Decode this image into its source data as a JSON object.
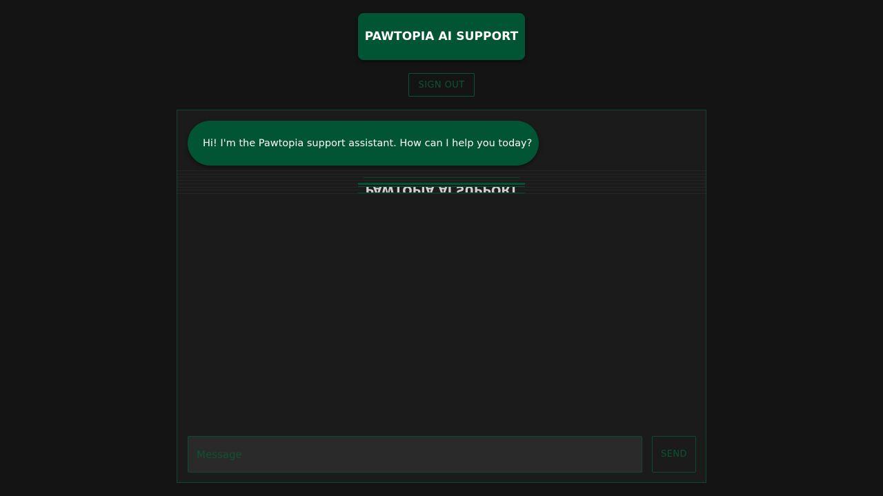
{
  "header": {
    "title": "PAWTOPIA AI SUPPORT",
    "sign_out_label": "SIGN OUT"
  },
  "chat": {
    "messages": [
      {
        "sender": "assistant",
        "text": "Hi! I'm the Pawtopia support assistant. How can I help you today?"
      }
    ],
    "input": {
      "value": "",
      "placeholder": "Message"
    },
    "send_label": "SEND"
  },
  "colors": {
    "page_background": "#141414",
    "panel_background": "#1b1b1b",
    "accent": "#015434",
    "accent_border": "#0e4a2e",
    "input_background": "#2a2a2a"
  }
}
